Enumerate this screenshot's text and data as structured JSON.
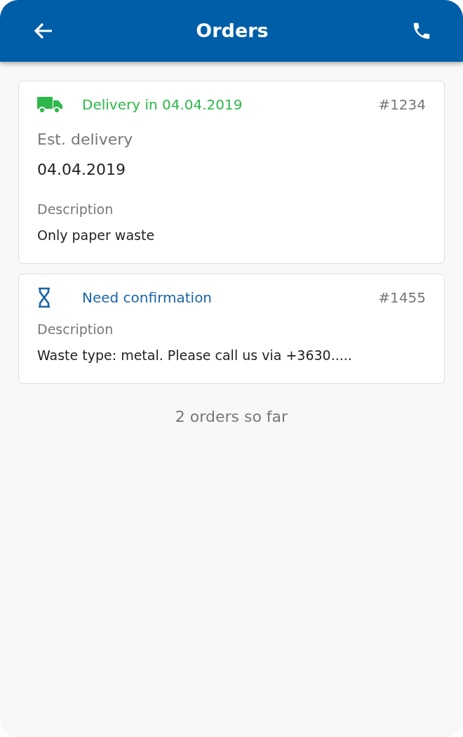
{
  "header": {
    "title": "Orders"
  },
  "orders": [
    {
      "kind": "delivery",
      "status": "Delivery in 04.04.2019",
      "color": "#2db84a",
      "number": "#1234",
      "fields": [
        {
          "kind": "large",
          "label": "Est. delivery",
          "value": "04.04.2019"
        },
        {
          "kind": "normal",
          "label": "Description",
          "value": "Only paper waste"
        }
      ]
    },
    {
      "kind": "confirmation",
      "status": "Need confirmation",
      "color": "#1a64a6",
      "number": "#1455",
      "fields": [
        {
          "kind": "normal",
          "label": "Description",
          "value": "Waste type: metal. Please call us via +3630....."
        }
      ]
    }
  ],
  "footer": "2 orders so far"
}
